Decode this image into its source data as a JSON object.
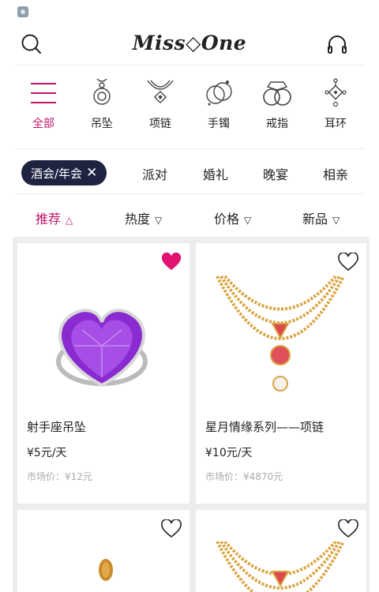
{
  "header": {
    "brand": "Miss◇One"
  },
  "categories": [
    {
      "label": "全部",
      "icon": "menu-lines-icon",
      "active": true
    },
    {
      "label": "吊坠",
      "icon": "pendant-icon",
      "active": false
    },
    {
      "label": "项链",
      "icon": "necklace-icon",
      "active": false
    },
    {
      "label": "手镯",
      "icon": "bracelet-icon",
      "active": false
    },
    {
      "label": "戒指",
      "icon": "ring-icon",
      "active": false
    },
    {
      "label": "耳环",
      "icon": "earring-icon",
      "active": false
    }
  ],
  "filters": {
    "selected": "酒会/年会",
    "others": [
      "派对",
      "婚礼",
      "晚宴",
      "相亲"
    ]
  },
  "sorts": [
    {
      "label": "推荐",
      "arrow": "△",
      "active": true
    },
    {
      "label": "热度",
      "arrow": "▽",
      "active": false
    },
    {
      "label": "价格",
      "arrow": "▽",
      "active": false
    },
    {
      "label": "新品",
      "arrow": "▽",
      "active": false
    }
  ],
  "products": [
    {
      "title": "射手座吊坠",
      "price": "¥5元/天",
      "market_price": "市场价：¥12元",
      "favorited": true,
      "image": "purple-heart-ring"
    },
    {
      "title": "星月情缘系列——项链",
      "price": "¥10元/天",
      "market_price": "市场价：¥4870元",
      "favorited": false,
      "image": "gold-layered-necklace"
    },
    {
      "title": "",
      "price": "",
      "market_price": "",
      "favorited": false,
      "image": "gold-pendant"
    },
    {
      "title": "",
      "price": "",
      "market_price": "",
      "favorited": false,
      "image": "gold-layered-necklace"
    }
  ],
  "colors": {
    "accent": "#c0166a",
    "chip_bg": "#1d2340",
    "heart_filled": "#e0136e"
  }
}
